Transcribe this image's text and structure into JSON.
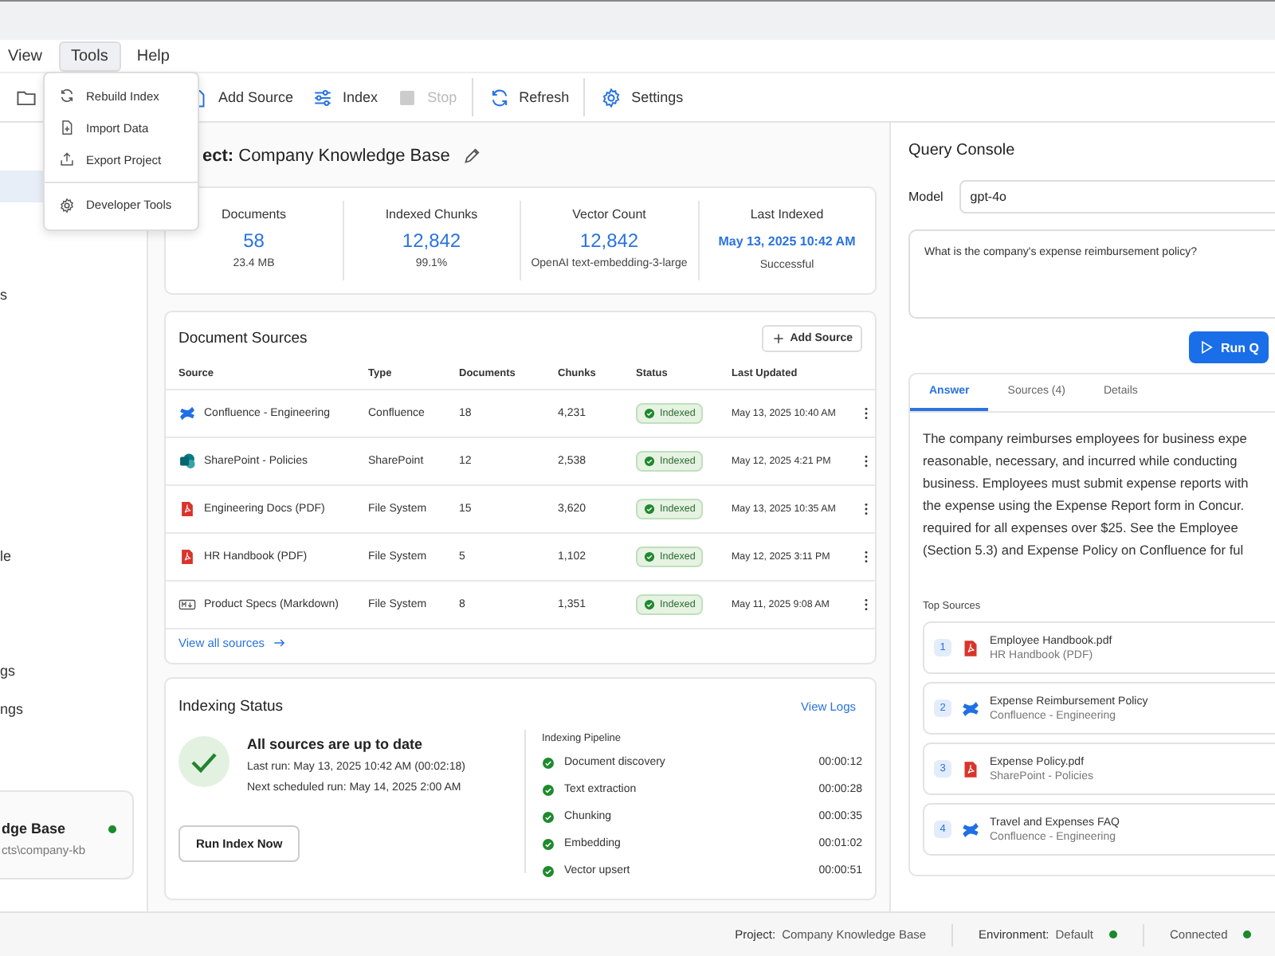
{
  "menubar": [
    {
      "label": "View",
      "selected": false
    },
    {
      "label": "Tools",
      "selected": true
    },
    {
      "label": "Help",
      "selected": false
    }
  ],
  "tools_menu": [
    {
      "label": "Rebuild Index",
      "kind": "refresh",
      "divider_before": false
    },
    {
      "label": "Import Data",
      "kind": "import",
      "divider_before": false
    },
    {
      "label": "Export Project",
      "kind": "export",
      "divider_before": false
    },
    {
      "label": "Developer Tools",
      "kind": "gear",
      "divider_before": true
    }
  ],
  "toolbar": [
    {
      "label": "Add Source",
      "kind": "addfile",
      "disabled": false,
      "divider_after": false
    },
    {
      "label": "Index",
      "kind": "sliders",
      "disabled": false,
      "divider_after": false
    },
    {
      "label": "Stop",
      "kind": "stop",
      "disabled": true,
      "divider_after": true
    },
    {
      "label": "Refresh",
      "kind": "refresh",
      "disabled": false,
      "divider_after": true
    },
    {
      "label": "Settings",
      "kind": "gear",
      "disabled": false,
      "divider_after": false
    }
  ],
  "sidebar": {
    "items": [
      {
        "selected": true
      },
      {
        "text": "s",
        "selected": false
      },
      {
        "text": "le",
        "selected": false
      },
      {
        "text": "gs",
        "selected": false
      },
      {
        "text": "ngs",
        "selected": false
      }
    ],
    "project_card": {
      "name": "dge Base",
      "path": "cts\\company-kb",
      "online": true
    }
  },
  "project": {
    "label": "ect:",
    "name": "Company Knowledge Base"
  },
  "stats": [
    {
      "label": "Documents",
      "value": "58",
      "sub": "23.4 MB"
    },
    {
      "label": "Indexed Chunks",
      "value": "12,842",
      "sub": "99.1%"
    },
    {
      "label": "Vector Count",
      "value": "12,842",
      "sub": "OpenAI text-embedding-3-large"
    },
    {
      "label": "Last Indexed",
      "value": "May 13, 2025 10:42 AM",
      "sub": "Successful"
    }
  ],
  "sources": {
    "title": "Document Sources",
    "add_button": "Add Source",
    "columns": [
      "Source",
      "Type",
      "Documents",
      "Chunks",
      "Status",
      "Last Updated"
    ],
    "rows": [
      {
        "kind": "confluence",
        "source": "Confluence - Engineering",
        "type": "Confluence",
        "documents": "18",
        "chunks": "4,231",
        "status": "Indexed",
        "updated": "May 13, 2025 10:40 AM"
      },
      {
        "kind": "sharepoint",
        "source": "SharePoint - Policies",
        "type": "SharePoint",
        "documents": "12",
        "chunks": "2,538",
        "status": "Indexed",
        "updated": "May 12, 2025 4:21 PM"
      },
      {
        "kind": "pdf",
        "source": "Engineering Docs (PDF)",
        "type": "File System",
        "documents": "15",
        "chunks": "3,620",
        "status": "Indexed",
        "updated": "May 13, 2025 10:35 AM"
      },
      {
        "kind": "pdf",
        "source": "HR Handbook (PDF)",
        "type": "File System",
        "documents": "5",
        "chunks": "1,102",
        "status": "Indexed",
        "updated": "May 12, 2025 3:11 PM"
      },
      {
        "kind": "markdown",
        "source": "Product Specs (Markdown)",
        "type": "File System",
        "documents": "8",
        "chunks": "1,351",
        "status": "Indexed",
        "updated": "May 11, 2025 9:08 AM"
      }
    ],
    "view_all": "View all sources"
  },
  "indexing": {
    "title": "Indexing Status",
    "view_logs": "View Logs",
    "headline": "All sources are up to date",
    "last_run": "Last run: May 13, 2025 10:42 AM (00:02:18)",
    "next_run": "Next scheduled run: May 14, 2025 2:00 AM",
    "run_button": "Run Index Now",
    "pipeline_title": "Indexing Pipeline",
    "steps": [
      {
        "name": "Document discovery",
        "time": "00:00:12",
        "done": true
      },
      {
        "name": "Text extraction",
        "time": "00:00:28",
        "done": true
      },
      {
        "name": "Chunking",
        "time": "00:00:35",
        "done": true
      },
      {
        "name": "Embedding",
        "time": "00:01:02",
        "done": true
      },
      {
        "name": "Vector upsert",
        "time": "00:00:51",
        "done": true
      }
    ]
  },
  "query": {
    "title": "Query Console",
    "model_label": "Model",
    "model": "gpt-4o",
    "question": "What is the company's expense reimbursement policy?",
    "run_button": "Run Q",
    "tabs": [
      {
        "label": "Answer",
        "selected": true
      },
      {
        "label": "Sources (4)",
        "selected": false
      },
      {
        "label": "Details",
        "selected": false
      }
    ],
    "answer_lines": [
      "The company reimburses employees for business expe",
      "reasonable, necessary, and incurred while conducting",
      "business. Employees must submit expense reports with",
      "the expense using the Expense Report form in Concur.",
      "required for all expenses over $25.   See the Employee",
      "(Section 5.3) and Expense Policy on Confluence for ful"
    ],
    "top_sources_title": "Top Sources",
    "top_sources": [
      {
        "index": "1",
        "kind": "pdf",
        "title": "Employee Handbook.pdf",
        "source": "HR Handbook (PDF)"
      },
      {
        "index": "2",
        "kind": "confluence",
        "title": "Expense Reimbursement Policy",
        "source": "Confluence - Engineering"
      },
      {
        "index": "3",
        "kind": "pdf",
        "title": "Expense Policy.pdf",
        "source": "SharePoint - Policies"
      },
      {
        "index": "4",
        "kind": "confluence",
        "title": "Travel and Expenses FAQ",
        "source": "Confluence - Engineering"
      }
    ]
  },
  "status_bar": [
    {
      "label": "Project:",
      "value": "Company Knowledge Base"
    },
    {
      "label": "Environment:",
      "value": "Default",
      "online": true
    },
    {
      "value": "Connected",
      "online": true
    }
  ]
}
